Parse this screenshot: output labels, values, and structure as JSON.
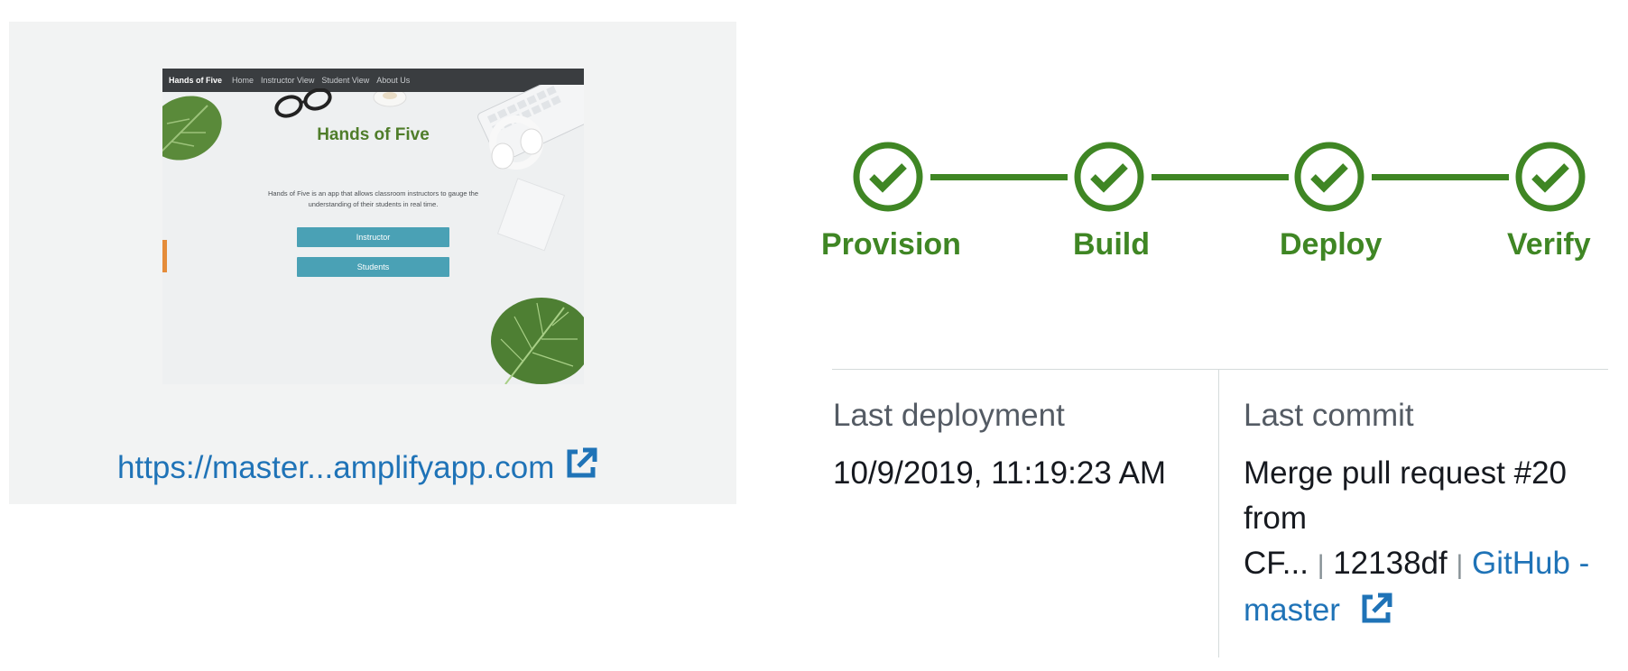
{
  "preview": {
    "thumbnail": {
      "nav_brand": "Hands of Five",
      "nav_links": [
        "Home",
        "Instructor View",
        "Student View",
        "About Us"
      ],
      "title": "Hands of Five",
      "description": "Hands of Five is an app that allows classroom instructors to gauge the understanding of their students in real time.",
      "buttons": [
        "Instructor",
        "Students"
      ]
    },
    "link_text": "https://master...amplifyapp.com",
    "link_icon": "external-link-icon"
  },
  "pipeline": {
    "status_color": "#3f8624",
    "stages": [
      {
        "label": "Provision",
        "status": "succeeded",
        "icon": "check-circle-icon"
      },
      {
        "label": "Build",
        "status": "succeeded",
        "icon": "check-circle-icon"
      },
      {
        "label": "Deploy",
        "status": "succeeded",
        "icon": "check-circle-icon"
      },
      {
        "label": "Verify",
        "status": "succeeded",
        "icon": "check-circle-icon"
      }
    ]
  },
  "details": {
    "last_deployment": {
      "label": "Last deployment",
      "value": "10/9/2019, 11:19:23 AM"
    },
    "last_commit": {
      "label": "Last commit",
      "message_line1": "Merge pull request #20",
      "message_line2": "from",
      "message_line3": "CF...",
      "separator": "|",
      "commit_id": "12138df",
      "repo_link_line1": "GitHub -",
      "repo_link_line2": "master",
      "link_icon": "external-link-icon"
    }
  },
  "colors": {
    "link": "#1f73b7",
    "success": "#3f8624",
    "card_bg": "#f2f3f3"
  }
}
